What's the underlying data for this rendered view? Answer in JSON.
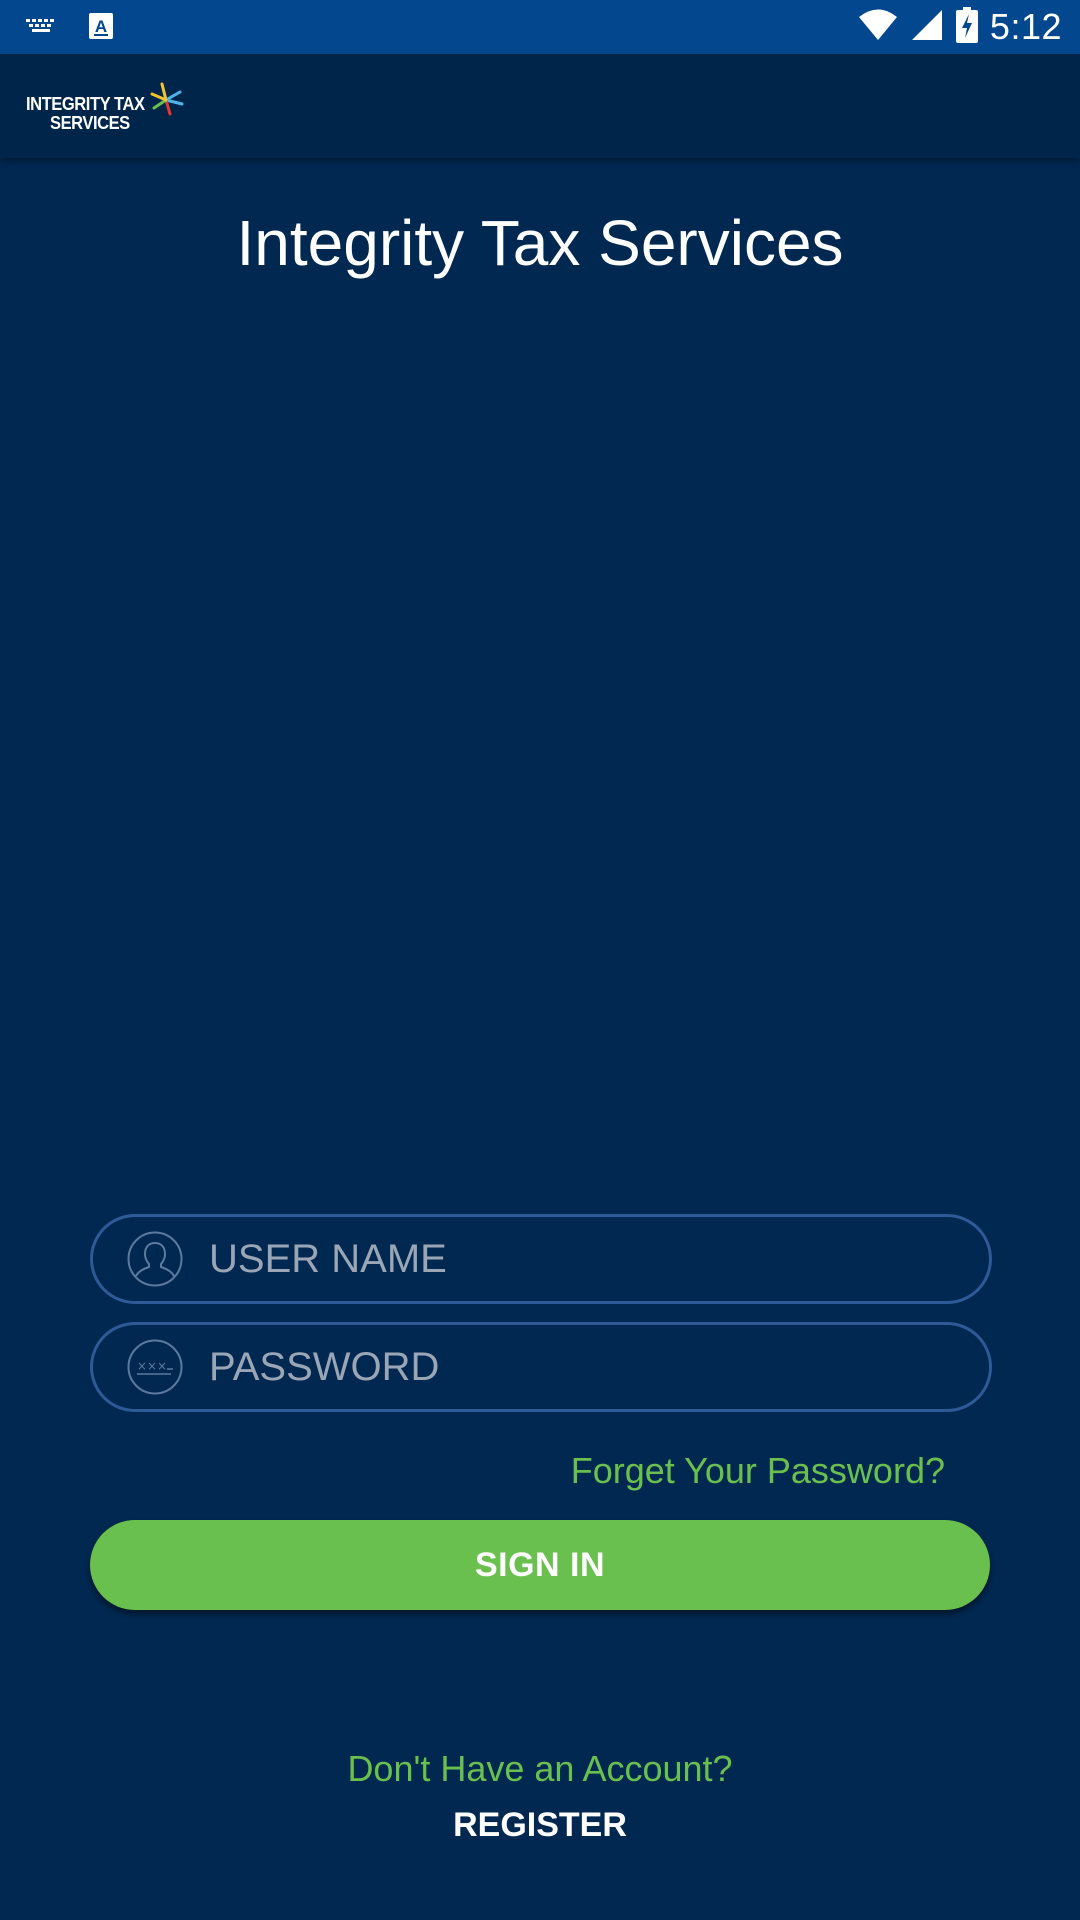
{
  "status_bar": {
    "time": "5:12",
    "icons": [
      "keyboard-icon",
      "text-input-icon",
      "wifi-icon",
      "signal-icon",
      "battery-charging-icon"
    ],
    "background": "#03488E"
  },
  "app_bar": {
    "logo_line1": "INTEGRITY TAX",
    "logo_line2": "SERVICES",
    "background": "#00254A"
  },
  "main": {
    "title": "Integrity Tax Services",
    "background": "#012850"
  },
  "login_form": {
    "username_placeholder": "USER NAME",
    "username_value": "",
    "password_placeholder": "PASSWORD",
    "password_value": "",
    "forgot_password": "Forget Your Password?",
    "sign_in": "SIGN IN",
    "no_account": "Don't Have an Account?",
    "register": "REGISTER"
  },
  "colors": {
    "accent_green": "#6AC04E",
    "field_border": "#2E5A97",
    "placeholder": "#9AA6B6"
  }
}
